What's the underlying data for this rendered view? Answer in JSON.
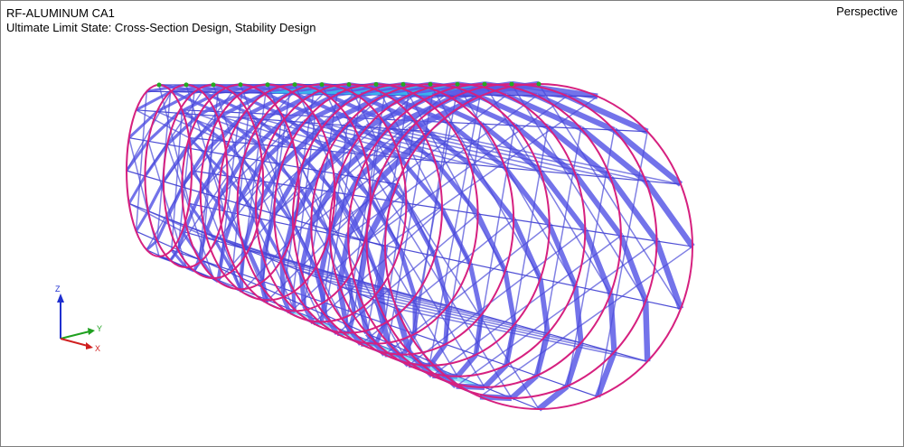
{
  "viewport": {
    "module_title": "RF-ALUMINUM CA1",
    "case_description": "Ultimate Limit State: Cross-Section Design, Stability Design",
    "projection": "Perspective"
  },
  "axes_triad": {
    "z_label": "Z",
    "y_label": "Y",
    "x_label": "X",
    "z_color": "#1f2fcf",
    "y_color": "#1fa01f",
    "x_color": "#d01f1f"
  },
  "model": {
    "ring_count": 15,
    "ring_color": "#d6207f",
    "member_result_color": "#5a5ae6",
    "highlight_result_color": "#33c8f0",
    "support_color": "#22aa22"
  }
}
